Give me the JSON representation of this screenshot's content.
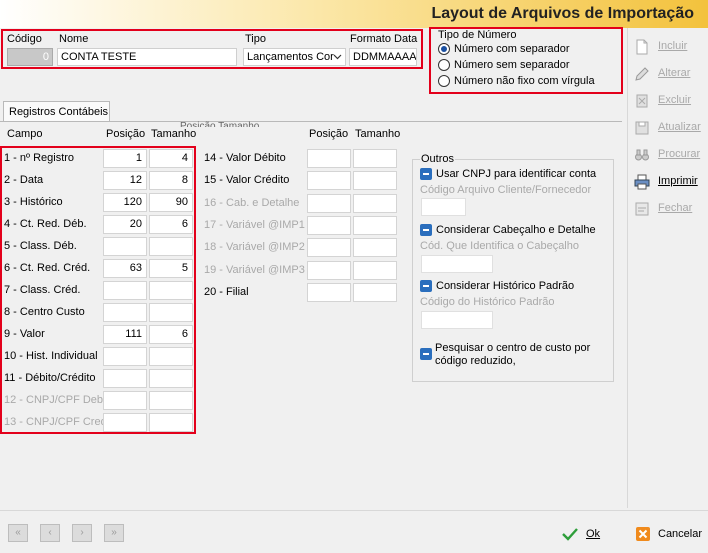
{
  "window": {
    "title": "Layout de Arquivos de Importação"
  },
  "header": {
    "codigo_label": "Código",
    "codigo_value": "0",
    "nome_label": "Nome",
    "nome_value": "CONTA TESTE",
    "tipo_label": "Tipo",
    "tipo_value": "Lançamentos Cor",
    "formato_label": "Formato Data",
    "formato_value": "DDMMAAAA"
  },
  "tipo_numero": {
    "legend": "Tipo de Número",
    "options": [
      "Número com separador",
      "Número sem separador",
      "Número não fixo com vírgula"
    ],
    "selected_index": 0
  },
  "tab": {
    "label": "Registros Contábeis"
  },
  "columns": {
    "campo": "Campo",
    "posicao": "Posição",
    "tamanho": "Tamanho",
    "posicao2": "Posição",
    "tamanho2": "Tamanho",
    "overlap_text": "Posição Tamanho"
  },
  "left_rows": [
    {
      "label": "1 - nº Registro",
      "pos": "1",
      "tam": "4",
      "enabled": true
    },
    {
      "label": "2 - Data",
      "pos": "12",
      "tam": "8",
      "enabled": true
    },
    {
      "label": "3 - Histórico",
      "pos": "120",
      "tam": "90",
      "enabled": true
    },
    {
      "label": "4 - Ct. Red. Déb.",
      "pos": "20",
      "tam": "6",
      "enabled": true
    },
    {
      "label": "5 - Class. Déb.",
      "pos": "",
      "tam": "",
      "enabled": true
    },
    {
      "label": "6 - Ct. Red. Créd.",
      "pos": "63",
      "tam": "5",
      "enabled": true
    },
    {
      "label": "7 -  Class. Créd.",
      "pos": "",
      "tam": "",
      "enabled": true
    },
    {
      "label": "8 - Centro Custo",
      "pos": "",
      "tam": "",
      "enabled": true
    },
    {
      "label": "9 - Valor",
      "pos": "111",
      "tam": "6",
      "enabled": true
    },
    {
      "label": "10 - Hist. Individual",
      "pos": "",
      "tam": "",
      "enabled": true
    },
    {
      "label": "11 - Débito/Crédito",
      "pos": "",
      "tam": "",
      "enabled": true
    },
    {
      "label": "12 - CNPJ/CPF Deb.",
      "pos": "",
      "tam": "",
      "enabled": false
    },
    {
      "label": "13 - CNPJ/CPF Cred.",
      "pos": "",
      "tam": "",
      "enabled": false
    }
  ],
  "right_rows": [
    {
      "label": "14 - Valor Débito",
      "enabled": true
    },
    {
      "label": "15 - Valor Crédito",
      "enabled": true
    },
    {
      "label": "16 - Cab. e Detalhe",
      "enabled": false
    },
    {
      "label": "17 - Variável @IMP1",
      "enabled": false
    },
    {
      "label": "18 - Variável @IMP2",
      "enabled": false
    },
    {
      "label": "19 - Variável @IMP3",
      "enabled": false
    },
    {
      "label": "20 - Filial",
      "enabled": true
    }
  ],
  "outros": {
    "legend": "Outros",
    "cnpj_label": "Usar CNPJ para identificar conta",
    "cnpj_sub": "Código Arquivo Cliente/Fornecedor",
    "cab_label": "Considerar Cabeçalho e Detalhe",
    "cab_sub": "Cód. Que Identifica o Cabeçalho",
    "hist_label": "Considerar Histórico Padrão",
    "hist_sub": "Código do Histórico Padrão",
    "cc_label_1": "Pesquisar o centro de custo por",
    "cc_label_2": "código reduzido,"
  },
  "side_buttons": [
    "Incluir",
    "Alterar",
    "Excluir",
    "Atualizar",
    "Procurar",
    "Imprimir",
    "Fechar"
  ],
  "footer": {
    "ok_label": "Ok",
    "cancel_label": "Cancelar"
  },
  "colors": {
    "highlight_red": "#e3001b",
    "check_blue": "#2a6ebd"
  }
}
